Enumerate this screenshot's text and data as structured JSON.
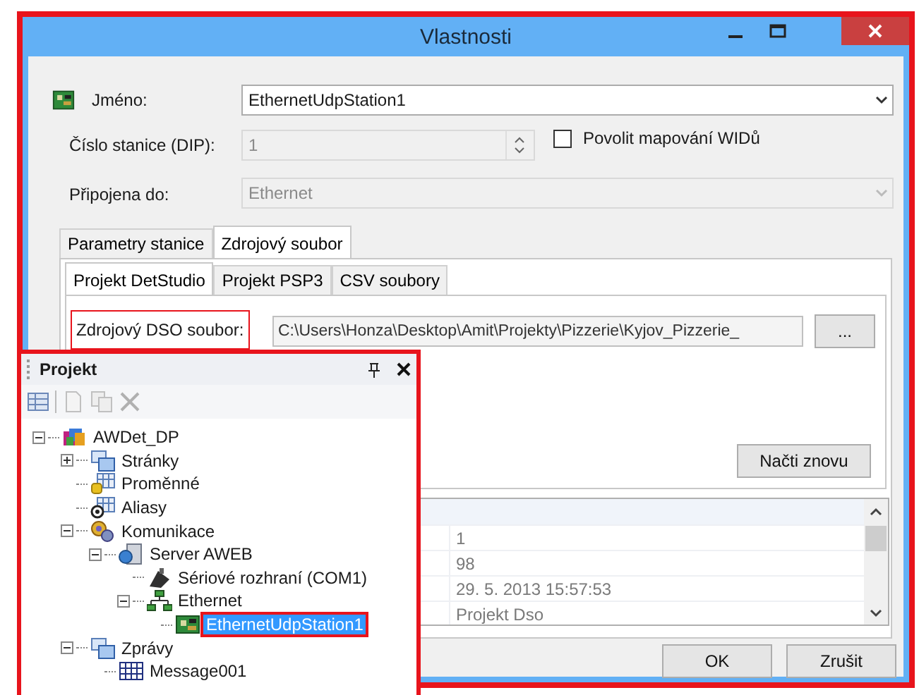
{
  "window": {
    "title": "Vlastnosti"
  },
  "form": {
    "name_label": "Jméno:",
    "name_value": "EthernetUdpStation1",
    "station_label": "Číslo stanice (DIP):",
    "station_value": "1",
    "station_disabled": true,
    "mapping_checkbox": {
      "label": "Povolit mapování WIDů",
      "checked": false
    },
    "connected_label": "Připojena do:",
    "connected_value": "Ethernet",
    "connected_disabled": true
  },
  "tabs": [
    {
      "label": "Parametry stanice",
      "selected": false
    },
    {
      "label": "Zdrojový soubor",
      "selected": true
    }
  ],
  "subtabs": [
    {
      "label": "Projekt DetStudio",
      "selected": true
    },
    {
      "label": "Projekt PSP3",
      "selected": false
    },
    {
      "label": "CSV soubory",
      "selected": false
    }
  ],
  "source": {
    "label": "Zdrojový DSO soubor:",
    "label_highlighted": true,
    "path": "C:\\Users\\Honza\\Desktop\\Amit\\Projekty\\Pizzerie\\Kyjov_Pizzerie_",
    "browse_button": "...",
    "reload_button": "Načti znovu"
  },
  "details_grid": {
    "rows": [
      {
        "value": "1"
      },
      {
        "value": "98"
      },
      {
        "value": "29. 5. 2013 15:57:53"
      },
      {
        "value": "Projekt Dso"
      }
    ]
  },
  "buttons": [
    "OK",
    "Zrušit"
  ],
  "project_panel": {
    "title": "Projekt",
    "tree": [
      {
        "label": "AWDet_DP",
        "kind": "project",
        "expanded": true,
        "selected": false,
        "children": [
          {
            "label": "Stránky",
            "kind": "pages",
            "expanded": false,
            "selected": false
          },
          {
            "label": "Proměnné",
            "kind": "variables",
            "selected": false
          },
          {
            "label": "Aliasy",
            "kind": "aliases",
            "selected": false
          },
          {
            "label": "Komunikace",
            "kind": "communication",
            "expanded": true,
            "selected": false,
            "children": [
              {
                "label": "Server AWEB",
                "kind": "server",
                "expanded": true,
                "selected": false,
                "children": [
                  {
                    "label": "Sériové rozhraní (COM1)",
                    "kind": "serial",
                    "selected": false
                  },
                  {
                    "label": "Ethernet",
                    "kind": "network",
                    "expanded": true,
                    "selected": false,
                    "children": [
                      {
                        "label": "EthernetUdpStation1",
                        "kind": "station",
                        "selected": true,
                        "highlighted": true
                      }
                    ]
                  }
                ]
              }
            ]
          },
          {
            "label": "Zprávy",
            "kind": "messages",
            "expanded": true,
            "selected": false,
            "children": [
              {
                "label": "Message001",
                "kind": "message",
                "selected": false
              }
            ]
          }
        ]
      }
    ]
  }
}
